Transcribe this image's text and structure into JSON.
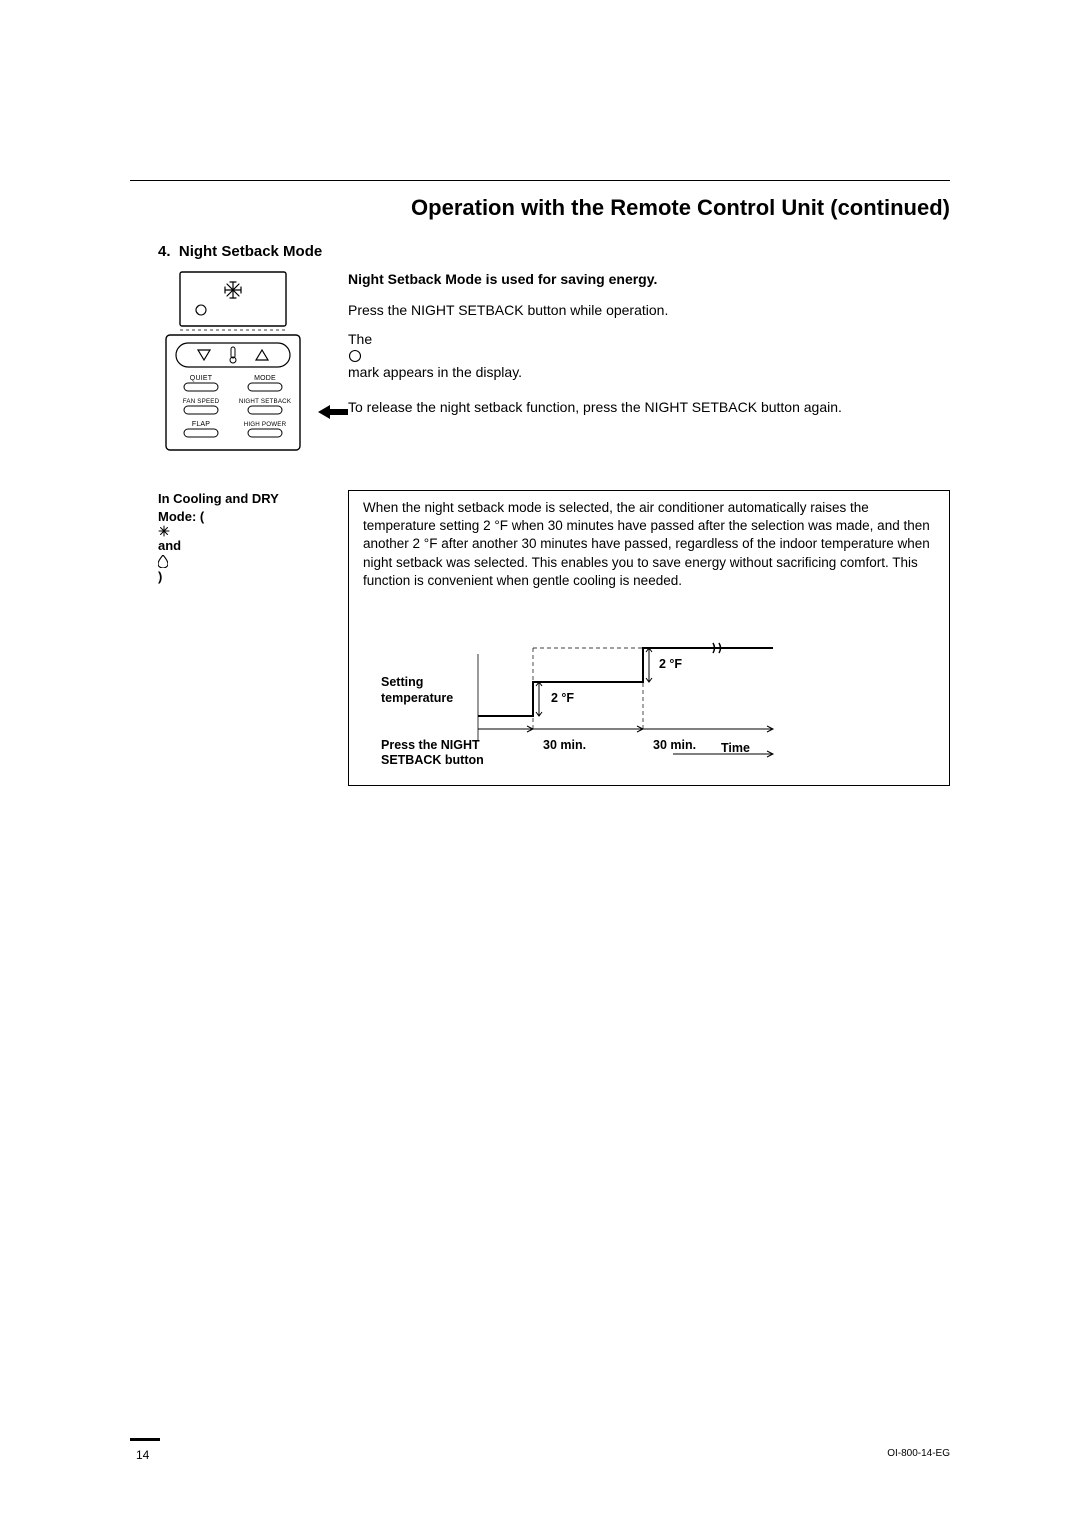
{
  "page": {
    "title": "Operation with the Remote Control Unit (continued)",
    "section_number": "4.",
    "section_heading": "Night Setback Mode",
    "intro_bold": "Night Setback Mode is used for saving energy.",
    "intro_line1": "Press the NIGHT SETBACK button while operation.",
    "intro_line2_pre": "The ",
    "intro_line2_post": " mark appears in the display.",
    "intro_line3": "To release the night setback function, press the NIGHT SETBACK button again.",
    "side_note_line1": "In Cooling and DRY",
    "side_note_line2_pre": "Mode: (",
    "side_note_line2_mid": " and ",
    "side_note_line2_post": ")",
    "box_paragraph": "When the night setback mode is selected, the air conditioner automatically raises the temperature setting 2 °F when 30 minutes have passed after the selection was made, and then another 2 °F after another 30 minutes have passed, regardless of the indoor temperature when night setback was selected. This enables you to save energy without sacrificing comfort. This function is convenient when gentle cooling is needed."
  },
  "remote": {
    "buttons": {
      "quiet": "QUIET",
      "mode": "MODE",
      "fan_speed": "FAN SPEED",
      "night_setback": "NIGHT SETBACK",
      "flap": "FLAP",
      "high_power": "HIGH POWER"
    }
  },
  "diagram": {
    "y_label": "Setting temperature",
    "x_action_line1": "Press the NIGHT",
    "x_action_line2": "SETBACK button",
    "step1": "2 °F",
    "step2": "2 °F",
    "interval1": "30 min.",
    "interval2": "30 min.",
    "time_label": "Time"
  },
  "chart_data": {
    "type": "line",
    "title": "Night setback temperature rise over time (Cooling/DRY mode)",
    "x": [
      0,
      30,
      30,
      60,
      60,
      120
    ],
    "y": [
      0,
      0,
      2,
      2,
      4,
      4
    ],
    "xlabel": "Time (min after pressing NIGHT SETBACK)",
    "ylabel": "Setting temperature change (°F)",
    "annotations": [
      "+2 °F at 30 min",
      "+2 °F at 60 min"
    ],
    "ylim": [
      0,
      4
    ]
  },
  "footer": {
    "page_number": "14",
    "doc_id": "OI-800-14-EG"
  }
}
